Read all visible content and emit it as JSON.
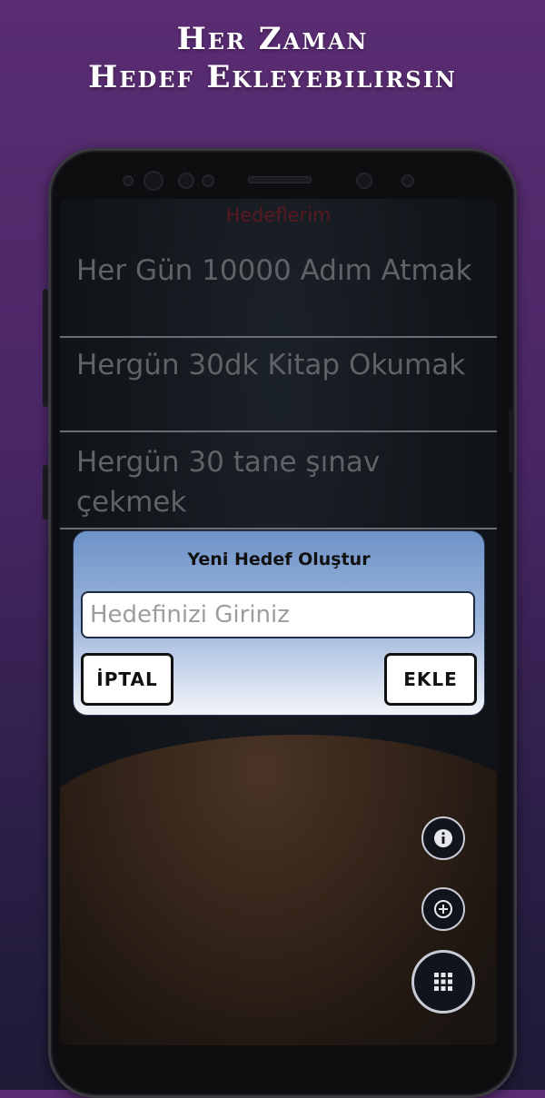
{
  "promo": {
    "line1": "Her Zaman",
    "line2": "Hedef Ekleyebilirsin"
  },
  "screen": {
    "title": "Hedeflerim",
    "goals": [
      {
        "text": "Her Gün 10000 Adım Atmak"
      },
      {
        "text": "Hergün 30dk Kitap Okumak"
      },
      {
        "text": "Hergün 30 tane şınav çekmek"
      }
    ]
  },
  "dialog": {
    "title": "Yeni Hedef Oluştur",
    "input_value": "",
    "input_placeholder": "Hedefinizi Giriniz",
    "cancel_label": "İPTAL",
    "add_label": "EKLE"
  },
  "fabs": [
    {
      "icon": "info-icon"
    },
    {
      "icon": "add-circle-icon"
    },
    {
      "icon": "grid-menu-icon"
    }
  ],
  "colors": {
    "background_top": "#5a2c72",
    "background_bottom": "#1d1a36",
    "screen_title": "#5a1820",
    "dialog_gradient_top": "#6f93c8"
  }
}
